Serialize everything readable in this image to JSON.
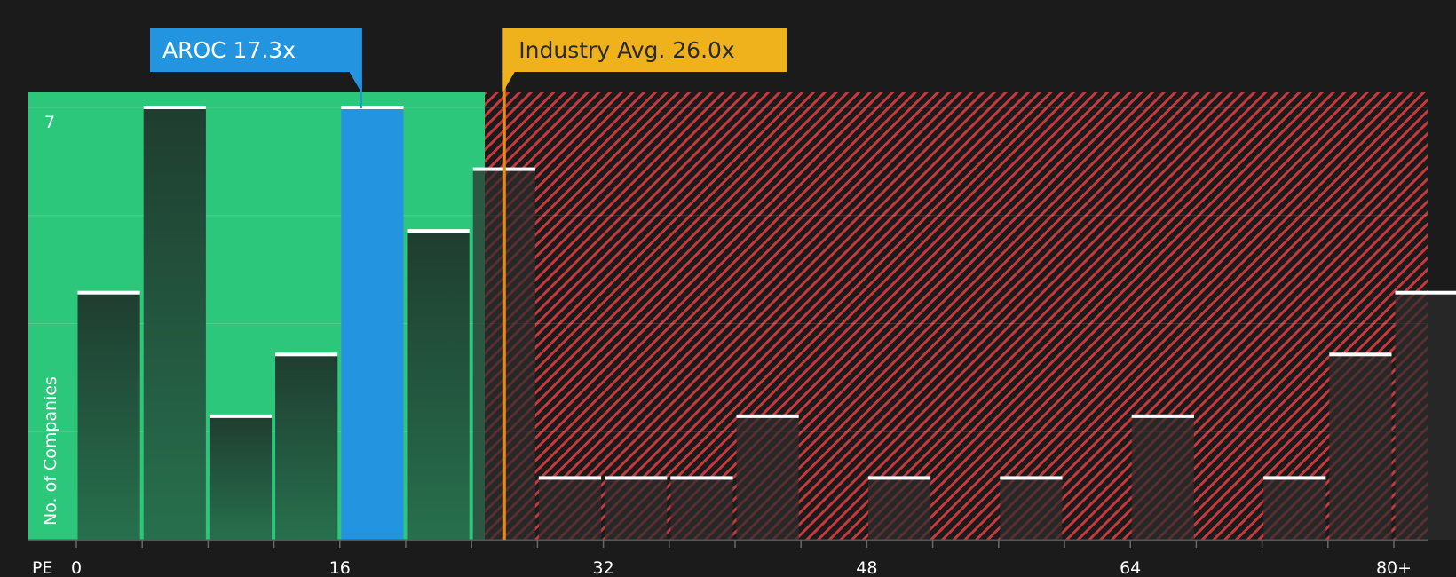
{
  "chart_data": {
    "type": "bar",
    "x_axis_label": "PE",
    "y_axis_label": "No. of Companies",
    "x_ticks": [
      "0",
      "16",
      "32",
      "48",
      "64",
      "80+"
    ],
    "x_tick_values": [
      0,
      16,
      32,
      48,
      64,
      80
    ],
    "y_tick_label": "7",
    "ylim": [
      0,
      7
    ],
    "xlim": [
      -3,
      82
    ],
    "bin_width": 4,
    "bars": [
      {
        "x0": 0,
        "value": 4,
        "highlight": false
      },
      {
        "x0": 4,
        "value": 7,
        "highlight": false
      },
      {
        "x0": 8,
        "value": 2,
        "highlight": false
      },
      {
        "x0": 12,
        "value": 3,
        "highlight": false
      },
      {
        "x0": 16,
        "value": 7,
        "highlight": true
      },
      {
        "x0": 20,
        "value": 5,
        "highlight": false
      },
      {
        "x0": 24,
        "value": 6,
        "highlight": false
      },
      {
        "x0": 28,
        "value": 1,
        "highlight": false
      },
      {
        "x0": 32,
        "value": 1,
        "highlight": false
      },
      {
        "x0": 36,
        "value": 1,
        "highlight": false
      },
      {
        "x0": 40,
        "value": 2,
        "highlight": false
      },
      {
        "x0": 44,
        "value": 0,
        "highlight": false
      },
      {
        "x0": 48,
        "value": 1,
        "highlight": false
      },
      {
        "x0": 52,
        "value": 0,
        "highlight": false
      },
      {
        "x0": 56,
        "value": 1,
        "highlight": false
      },
      {
        "x0": 60,
        "value": 0,
        "highlight": false
      },
      {
        "x0": 64,
        "value": 2,
        "highlight": false
      },
      {
        "x0": 68,
        "value": 0,
        "highlight": false
      },
      {
        "x0": 72,
        "value": 1,
        "highlight": false
      },
      {
        "x0": 76,
        "value": 3,
        "highlight": false
      },
      {
        "x0": 80,
        "value": 4,
        "highlight": false
      }
    ],
    "company": {
      "label": "AROC 17.3x",
      "value": 17.3
    },
    "industry": {
      "label": "Industry Avg. 26.0x",
      "value": 26.0
    },
    "zones": {
      "good_max": 24.8
    },
    "colors": {
      "background": "#1b1b1b",
      "good_zone": "#2dc77b",
      "bad_zone": "#c8383c",
      "bar": "#224a38",
      "bar_bad": "#2b2b2b",
      "highlight_bar": "#2394e0",
      "company_callout": "#2394e0",
      "industry_callout": "#f0b21c",
      "industry_line": "#e88a10"
    }
  }
}
